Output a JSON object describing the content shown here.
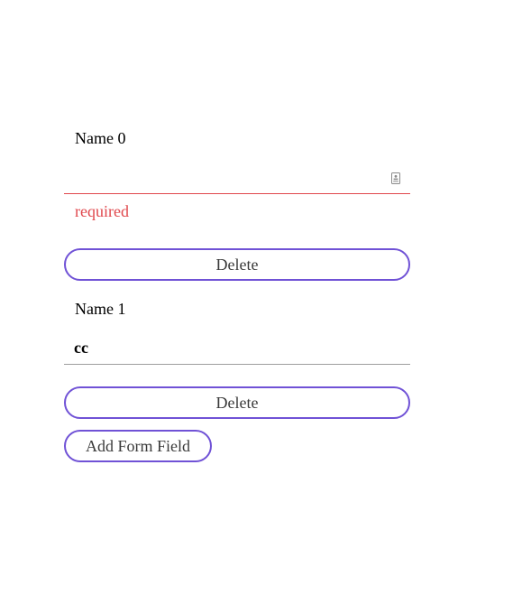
{
  "form": {
    "fields": [
      {
        "label": "Name 0",
        "value": "",
        "error": "required",
        "delete_label": "Delete"
      },
      {
        "label": "Name 1",
        "value": "cc",
        "delete_label": "Delete"
      }
    ],
    "add_label": "Add Form Field"
  },
  "colors": {
    "accent": "#7052d6",
    "error": "#e0474c",
    "underline": "#9e9e9e"
  }
}
